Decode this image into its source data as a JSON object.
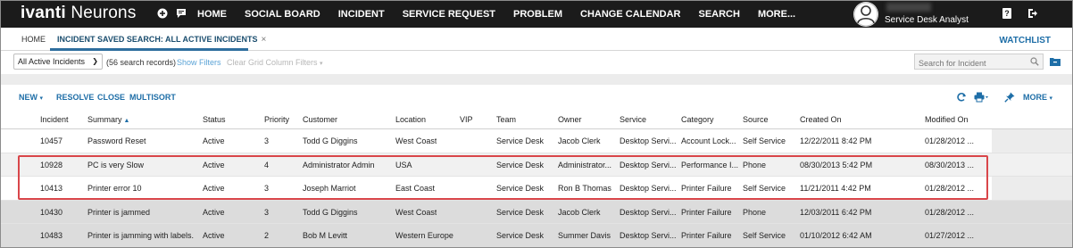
{
  "topnav": {
    "logo_brand": "ivanti",
    "logo_product": "Neurons",
    "items": [
      "HOME",
      "SOCIAL BOARD",
      "INCIDENT",
      "SERVICE REQUEST",
      "PROBLEM",
      "CHANGE CALENDAR",
      "SEARCH",
      "MORE..."
    ],
    "user_role": "Service Desk Analyst"
  },
  "tabs": {
    "home": "HOME",
    "active": "INCIDENT SAVED SEARCH: ALL ACTIVE INCIDENTS",
    "close_symbol": "×",
    "watchlist": "WATCHLIST"
  },
  "searchbar": {
    "saved_search": "All Active Incidents",
    "records": "(56 search records)",
    "show_filters": "Show Filters",
    "clear_filters": "Clear Grid Column Filters",
    "search_placeholder": "Search for Incident"
  },
  "toolbar": {
    "new": "NEW",
    "resolve": "RESOLVE",
    "close": "CLOSE",
    "multisort": "MULTISORT",
    "more": "MORE"
  },
  "grid": {
    "columns": [
      "Incident",
      "Summary",
      "Status",
      "Priority",
      "Customer",
      "Location",
      "VIP",
      "Team",
      "Owner",
      "Service",
      "Category",
      "Source",
      "Created On",
      "Modified On"
    ],
    "sorted_column": "Summary",
    "rows": [
      [
        "10457",
        "Password Reset",
        "Active",
        "3",
        "Todd G Diggins",
        "West Coast",
        "",
        "Service Desk",
        "Jacob Clerk",
        "Desktop Servi...",
        "Account Lock...",
        "Self Service",
        "12/22/2011 8:42 PM",
        "01/28/2012 ..."
      ],
      [
        "10928",
        "PC is very Slow",
        "Active",
        "4",
        "Administrator Admin",
        "USA",
        "",
        "Service Desk",
        "Administrator...",
        "Desktop Servi...",
        "Performance I...",
        "Phone",
        "08/30/2013 5:42 PM",
        "08/30/2013 ..."
      ],
      [
        "10413",
        "Printer error 10",
        "Active",
        "3",
        "Joseph Marriot",
        "East Coast",
        "",
        "Service Desk",
        "Ron B Thomas",
        "Desktop Servi...",
        "Printer Failure",
        "Self Service",
        "11/21/2011 4:42 PM",
        "01/28/2012 ..."
      ],
      [
        "10430",
        "Printer is jammed",
        "Active",
        "3",
        "Todd G Diggins",
        "West Coast",
        "",
        "Service Desk",
        "Jacob Clerk",
        "Desktop Servi...",
        "Printer Failure",
        "Phone",
        "12/03/2011 6:42 PM",
        "01/28/2012 ..."
      ],
      [
        "10483",
        "Printer is jamming with labels.",
        "Active",
        "2",
        "Bob M Levitt",
        "Western Europe",
        "",
        "Service Desk",
        "Summer Davis",
        "Desktop Servi...",
        "Printer Failure",
        "Self Service",
        "01/10/2012 6:42 AM",
        "01/27/2012 ..."
      ]
    ]
  },
  "colors": {
    "nav_bg": "#1b1b1b",
    "accent": "#1e6ea7",
    "highlight_box": "#d9464a"
  }
}
